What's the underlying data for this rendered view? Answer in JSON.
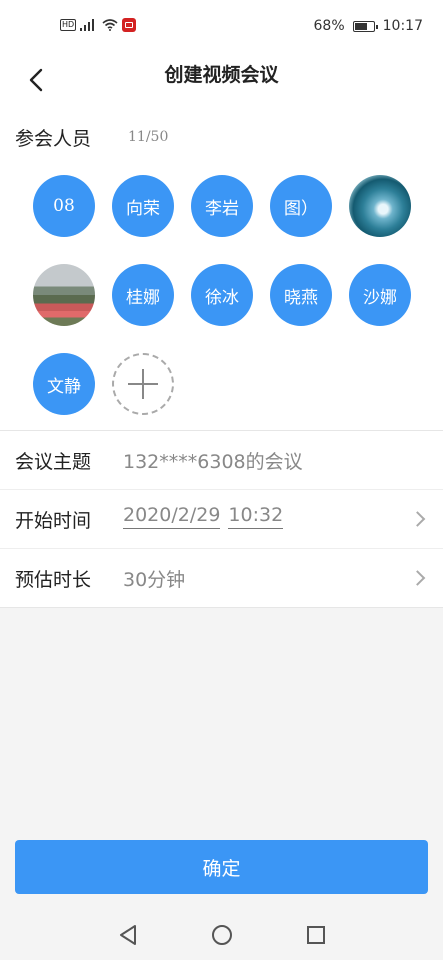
{
  "status": {
    "battery_text": "68%",
    "battery_level": 0.68,
    "time": "10:17"
  },
  "header": {
    "title": "创建视频会议",
    "back_icon": "chevron-left-icon"
  },
  "participants": {
    "label": "参会人员",
    "count": "11/50",
    "members": [
      {
        "text": "08"
      },
      {
        "text": "向荣"
      },
      {
        "text": "李岩"
      },
      {
        "text": "图）"
      },
      {
        "text": "",
        "avatar": "wave-photo"
      },
      {
        "text": "",
        "avatar": "garden-photo"
      },
      {
        "text": "桂娜"
      },
      {
        "text": "徐冰"
      },
      {
        "text": "晓燕"
      },
      {
        "text": "沙娜"
      },
      {
        "text": "文静"
      }
    ],
    "add_icon": "plus-icon"
  },
  "form": {
    "topic_label": "会议主题",
    "topic_value": "132****6308的会议",
    "start_label": "开始时间",
    "start_date": "2020/2/29",
    "start_time": "10:32",
    "duration_label": "预估时长",
    "duration_value": "30分钟"
  },
  "confirm_label": "确定",
  "colors": {
    "accent": "#3b96f5",
    "background": "#f4f4f4"
  }
}
